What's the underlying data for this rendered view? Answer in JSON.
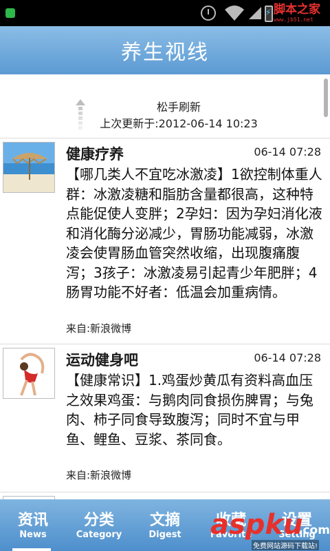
{
  "status_bar": {
    "watermark_title": "脚本之家",
    "watermark_url": "www.jb51.net"
  },
  "header": {
    "title": "养生视线"
  },
  "refresh": {
    "pull_text": "松手刷新",
    "last_updated": "上次更新于:2012-06-14 10:23"
  },
  "feed": [
    {
      "source_name": "健康疗养",
      "time": "06-14 07:28",
      "body": "【哪几类人不宜吃冰激凌】1欲控制体重人群：冰激凌糖和脂肪含量都很高，这种特点能促使人变胖；2孕妇：因为孕妇消化液和消化酶分泌减少，胃肠功能减弱，冰激凌会使胃肠血管突然收缩，出现腹痛腹泻；3孩子：冰激凌易引起青少年肥胖；4肠胃功能不好者：低温会加重病情。",
      "from": "来自:新浪微博",
      "thumb": "beach-umbrella-image"
    },
    {
      "source_name": "运动健身吧",
      "time": "06-14 07:28",
      "body": "【健康常识】1.鸡蛋炒黄瓜有资料高血压之效果鸡蛋：与鹅肉同食损伤脾胃；与兔肉、柿子同食导致腹泻；同时不宜与甲鱼、鲤鱼、豆浆、茶同食。",
      "from": "来自:新浪微博",
      "thumb": "gymnast-image"
    }
  ],
  "tabs": [
    {
      "zh": "资讯",
      "en": "News",
      "active": true
    },
    {
      "zh": "分类",
      "en": "Category",
      "active": false
    },
    {
      "zh": "文摘",
      "en": "Digest",
      "active": false
    },
    {
      "zh": "收藏",
      "en": "Favorite",
      "active": false
    },
    {
      "zh": "设置",
      "en": "Setting",
      "active": false
    }
  ],
  "bottom_watermark": {
    "logo": "aspku",
    "tld": ".com",
    "sub": "免费网站源码下载站!"
  },
  "colors": {
    "header_gradient_top": "#8bbde6",
    "header_gradient_bottom": "#5b9ad3",
    "watermark_red": "#e83030"
  }
}
